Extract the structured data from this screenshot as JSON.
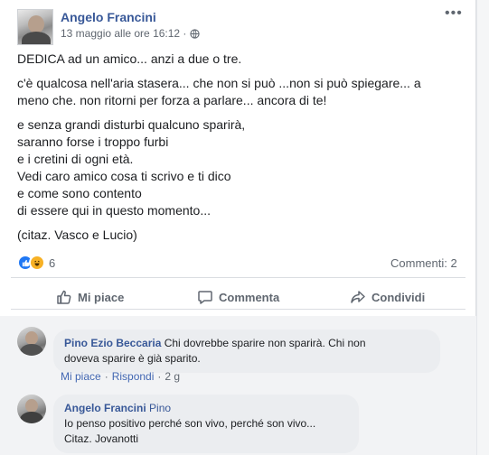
{
  "post": {
    "author": "Angelo Francini",
    "date": "13 maggio alle ore 16:12 ·",
    "menu_label": "•••",
    "paragraphs": [
      [
        "DEDICA ad un amico... anzi a due o tre."
      ],
      [
        "c'è qualcosa nell'aria stasera... che non si può ...non si può spiegare... a",
        "meno che. non ritorni per forza a parlare... ancora di te!"
      ],
      [
        "e senza grandi disturbi qualcuno sparirà,",
        "saranno forse i troppo furbi",
        "e i cretini di ogni età.",
        "Vedi caro amico cosa ti scrivo e ti dico",
        "e come sono contento",
        "di essere qui in questo momento..."
      ],
      [
        "(citaz. Vasco e Lucio)"
      ]
    ],
    "reaction_count": "6",
    "comments_count": "Commenti: 2"
  },
  "actions": {
    "like": "Mi piace",
    "comment": "Commenta",
    "share": "Condividi"
  },
  "comments": [
    {
      "author": "Pino Ezio Beccaria",
      "text_line1": " Chi dovrebbe sparire non sparirà. Chi non",
      "text_line2": "doveva sparire è già sparito.",
      "like": "Mi piace",
      "sep1": "·",
      "reply": "Rispondi",
      "sep2": "·",
      "time": "2 g"
    },
    {
      "author": "Angelo Francini",
      "mention": " Pino",
      "text_line1": "Io penso positivo perché son vivo, perché son vivo...",
      "text_line2": "Citaz. Jovanotti"
    }
  ],
  "colors": {
    "link": "#385898",
    "like_blue": "#2078f4",
    "haha_yellow": "#f7b125",
    "muted": "#606770"
  },
  "icons": [
    "globe-icon",
    "like-reaction-icon",
    "haha-reaction-icon",
    "thumb-up-icon",
    "comment-bubble-icon",
    "share-arrow-icon"
  ]
}
